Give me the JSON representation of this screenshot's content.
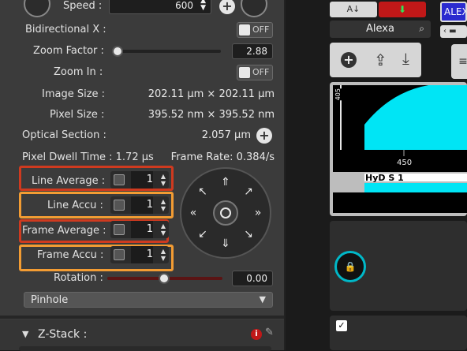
{
  "speed": {
    "label": "Speed :",
    "value": "600"
  },
  "bidirectional": {
    "label": "Bidirectional X :",
    "state": "OFF"
  },
  "zoom_factor": {
    "label": "Zoom Factor :",
    "value": "2.88",
    "slider_fraction": 0.0
  },
  "zoom_in": {
    "label": "Zoom In :",
    "state": "OFF"
  },
  "image_size": {
    "label": "Image Size :",
    "value": "202.11 µm × 202.11 µm"
  },
  "pixel_size": {
    "label": "Pixel Size :",
    "value": "395.52 nm × 395.52 nm"
  },
  "optical_section": {
    "label": "Optical Section :",
    "value": "2.057 µm"
  },
  "pixel_dwell": "Pixel Dwell Time : 1.72 µs",
  "frame_rate": "Frame Rate: 0.384/s",
  "line_average": {
    "label": "Line Average :",
    "value": "1"
  },
  "line_accu": {
    "label": "Line Accu :",
    "value": "1"
  },
  "frame_average": {
    "label": "Frame Average :",
    "value": "1"
  },
  "frame_accu": {
    "label": "Frame Accu :",
    "value": "1"
  },
  "rotation": {
    "label": "Rotation :",
    "value": "0.00",
    "slider_fraction": 0.5
  },
  "pinhole": {
    "label": "Pinhole"
  },
  "zstack": {
    "label": "Z-Stack :"
  },
  "right_panel": {
    "user_name": "Alexa",
    "top_label": "ALEX",
    "spectrum_tick_450": "450",
    "spectrum_tick_405": "405",
    "detector_label": "HyD S 1"
  },
  "colors": {
    "highlight_red": "#cf3a1f",
    "highlight_orange": "#f39c33",
    "spectrum_cyan": "#00e5f5"
  }
}
